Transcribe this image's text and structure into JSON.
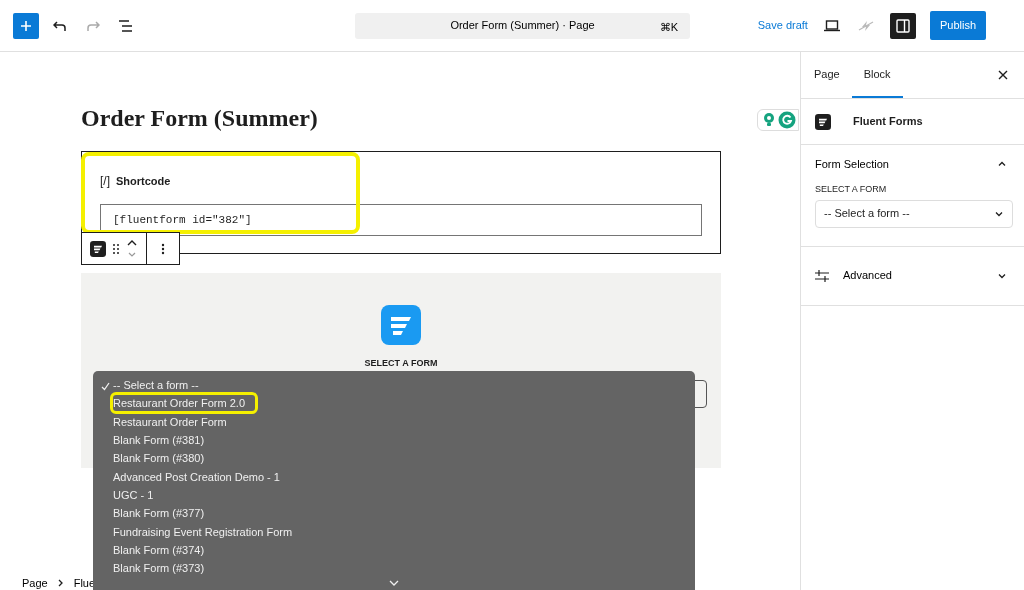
{
  "toolbar": {
    "document_title": "Order Form (Summer) · Page",
    "shortcut": "⌘K",
    "save_label": "Save draft",
    "publish_label": "Publish",
    "sidebar_open": true
  },
  "editor": {
    "title": "Order Form (Summer)",
    "shortcode_block": {
      "icon": "[/]",
      "label": "Shortcode",
      "value": "[fluentform id=\"382\"]",
      "highlighted": true
    },
    "form_block": {
      "label": "SELECT A FORM",
      "options": [
        {
          "label": "-- Select a form --",
          "selected": true,
          "highlighted": false
        },
        {
          "label": "Restaurant Order Form 2.0",
          "selected": false,
          "highlighted": true
        },
        {
          "label": "Restaurant Order Form",
          "selected": false,
          "highlighted": false
        },
        {
          "label": "Blank Form (#381)",
          "selected": false,
          "highlighted": false
        },
        {
          "label": "Blank Form (#380)",
          "selected": false,
          "highlighted": false
        },
        {
          "label": "Advanced Post Creation Demo - 1",
          "selected": false,
          "highlighted": false
        },
        {
          "label": "UGC - 1",
          "selected": false,
          "highlighted": false
        },
        {
          "label": "Blank Form (#377)",
          "selected": false,
          "highlighted": false
        },
        {
          "label": "Fundraising Event Registration Form",
          "selected": false,
          "highlighted": false
        },
        {
          "label": "Blank Form (#374)",
          "selected": false,
          "highlighted": false
        },
        {
          "label": "Blank Form (#373)",
          "selected": false,
          "highlighted": false
        }
      ]
    },
    "breadcrumb": [
      "Page",
      "Flue"
    ]
  },
  "sidebar": {
    "tabs": [
      {
        "label": "Page",
        "selected": false
      },
      {
        "label": "Block",
        "selected": true
      }
    ],
    "block_name": "Fluent Forms",
    "panels": [
      {
        "title": "Form Selection",
        "expanded": true,
        "field_label": "SELECT A FORM",
        "field_value": "-- Select a form --"
      },
      {
        "title": "Advanced",
        "expanded": false
      }
    ]
  }
}
